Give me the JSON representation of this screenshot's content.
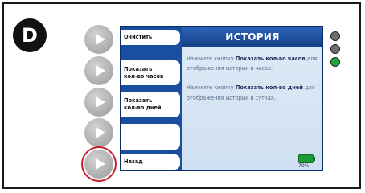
{
  "badge": {
    "letter": "D"
  },
  "screen": {
    "title": "ИСТОРИЯ",
    "menu": [
      {
        "label": "Очистить"
      },
      {
        "label": "Показать\nкол-во часов"
      },
      {
        "label": "Показать\nкол-во дней"
      },
      {
        "label": ""
      },
      {
        "label": "Назад"
      }
    ],
    "help": {
      "p1_before": "Нажмите кнопку ",
      "p1_bold": "Показать кол-во часов",
      "p1_after": " для отображения истории в часах.",
      "p2_before": "Нажмите кнопку ",
      "p2_bold": "Показать кол-во дней",
      "p2_after": " для отображения истории в сутках."
    },
    "battery": {
      "percent_text": "70%",
      "level": 0.7,
      "color": "#1f9a38"
    }
  },
  "indicators": [
    {
      "color": "#6f6f6f"
    },
    {
      "color": "#6f6f6f"
    },
    {
      "color": "#22a83a"
    }
  ],
  "colors": {
    "highlight_ring": "#c8202e",
    "screen_blue": "#1a4fa0"
  }
}
